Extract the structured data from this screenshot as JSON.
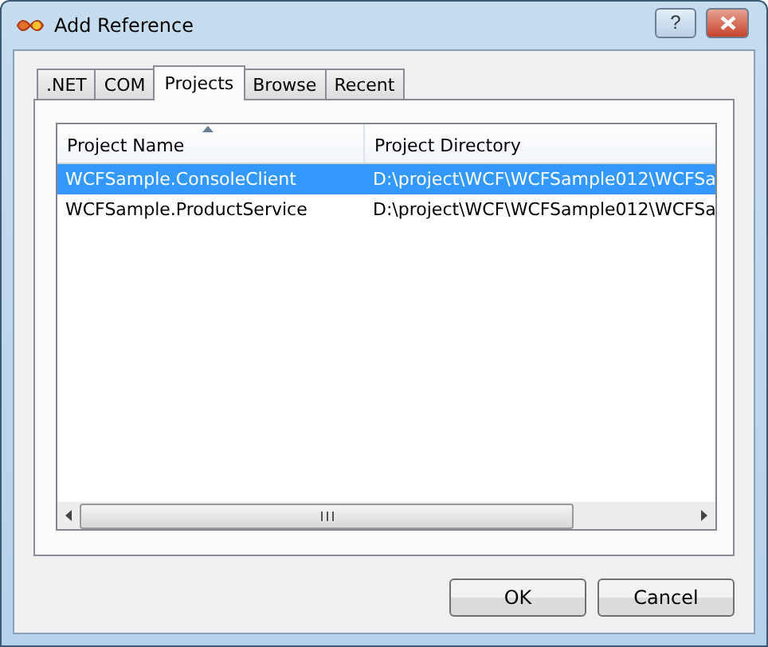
{
  "window": {
    "title": "Add Reference",
    "help_button": "?"
  },
  "tabs": [
    {
      "label": ".NET",
      "selected": false
    },
    {
      "label": "COM",
      "selected": false
    },
    {
      "label": "Projects",
      "selected": true
    },
    {
      "label": "Browse",
      "selected": false
    },
    {
      "label": "Recent",
      "selected": false
    }
  ],
  "table": {
    "columns": [
      "Project Name",
      "Project Directory"
    ],
    "rows": [
      {
        "cells": [
          "WCFSample.ConsoleClient",
          "D:\\project\\WCF\\WCFSample012\\WCFSa"
        ],
        "selected": true
      },
      {
        "cells": [
          "WCFSample.ProductService",
          "D:\\project\\WCF\\WCFSample012\\WCFSa"
        ],
        "selected": false
      }
    ]
  },
  "buttons": [
    "OK",
    "Cancel"
  ]
}
